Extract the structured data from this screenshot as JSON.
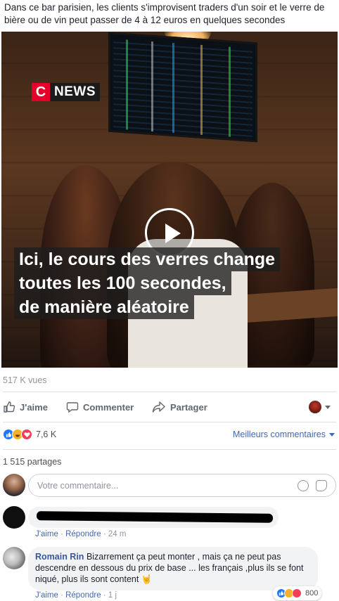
{
  "post": {
    "caption": "Dans ce bar parisien, les clients s'improvisent traders d'un soir et le verre de bière ou de vin peut passer de 4 à 12 euros en quelques secondes",
    "video": {
      "logo_c": "C",
      "logo_news": "NEWS",
      "overlay_lines": [
        "Ici, le cours des verres change",
        "toutes les 100 secondes,",
        "de manière aléatoire"
      ]
    },
    "views": "517 K vues"
  },
  "actions": {
    "like": "J'aime",
    "comment": "Commenter",
    "share": "Partager"
  },
  "reactions": {
    "count": "7,6 K",
    "types": [
      "like",
      "haha",
      "love"
    ],
    "sort_label": "Meilleurs commentaires"
  },
  "shares": "1 515 partages",
  "comment_input": {
    "placeholder": "Votre commentaire..."
  },
  "comments": [
    {
      "author": "",
      "text": "",
      "like_label": "J'aime",
      "reply_label": "Répondre",
      "time": "24 m"
    },
    {
      "author": "Romain Rin",
      "text": "Bizarrement ça peut monter , mais ça ne peut pas descendre en dessous du prix de base ... les français ,plus ils se font niqué, plus ils sont content 🤘",
      "like_label": "J'aime",
      "reply_label": "Répondre",
      "time": "1 j",
      "reaction_count": "800"
    }
  ],
  "colors": {
    "link_blue": "#4267b2",
    "author_blue": "#385898",
    "muted": "#90949c",
    "cnews_red": "#e4002b"
  }
}
